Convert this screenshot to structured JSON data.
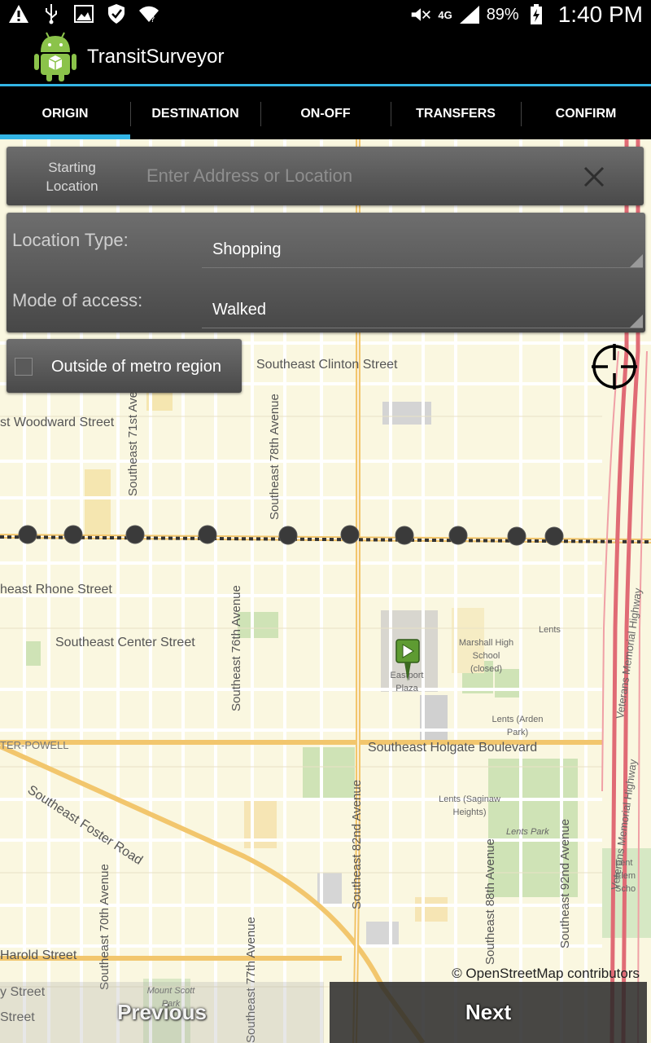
{
  "status_bar": {
    "battery_percent": "89%",
    "time": "1:40 PM",
    "network": "4G",
    "icons": [
      "warning-icon",
      "usb-icon",
      "image-icon",
      "shield-icon",
      "wifi-icon",
      "mute-icon",
      "signal-icon",
      "battery-charging-icon"
    ]
  },
  "app": {
    "title": "TransitSurveyor",
    "accent": "#33b5e5"
  },
  "tabs": [
    {
      "label": "ORIGIN",
      "active": true
    },
    {
      "label": "DESTINATION",
      "active": false
    },
    {
      "label": "ON-OFF",
      "active": false
    },
    {
      "label": "TRANSFERS",
      "active": false
    },
    {
      "label": "CONFIRM",
      "active": false
    }
  ],
  "location": {
    "label_line1": "Starting",
    "label_line2": "Location",
    "placeholder": "Enter Address or Location",
    "value": ""
  },
  "details": {
    "location_type_label": "Location Type:",
    "location_type_value": "Shopping",
    "mode_label": "Mode of access:",
    "mode_value": "Walked"
  },
  "outside_metro": {
    "label": "Outside of metro region",
    "checked": false
  },
  "map": {
    "labels": {
      "clinton": "Southeast Clinton Street",
      "woodward": "st Woodward Street",
      "se71": "Southeast 71st Avenue",
      "se78": "Southeast 78th Avenue",
      "rhone": "heast Rhone Street",
      "center": "Southeast Center Street",
      "se76": "Southeast 76th Avenue",
      "marshall": "Marshall High School (closed)",
      "eastport": "Eastport Plaza",
      "lents": "Lents",
      "lents_arden": "Lents (Arden Park)",
      "holgate": "Southeast Holgate Boulevard",
      "powell": "TER-POWELL",
      "foster": "Southeast Foster Road",
      "se82": "Southeast 82nd Avenue",
      "lents_saginaw": "Lents (Saginaw Heights)",
      "lents_park": "Lents Park",
      "se88": "Southeast 88th Avenue",
      "se92": "Southeast 92nd Avenue",
      "se70": "Southeast 70th Avenue",
      "harold": "Harold Street",
      "mount_scott": "Mount Scott Park",
      "se77": "Southeast 77th Avenue",
      "street1": "y Street",
      "street2": "Street",
      "hwy1": "Veterans Memorial Highway",
      "hwy2": "Veterans Memorial Highway",
      "lent_elem": "Lent Elem Scho"
    },
    "attribution": "© OpenStreetMap contributors"
  },
  "buttons": {
    "previous": "Previous",
    "next": "Next"
  }
}
